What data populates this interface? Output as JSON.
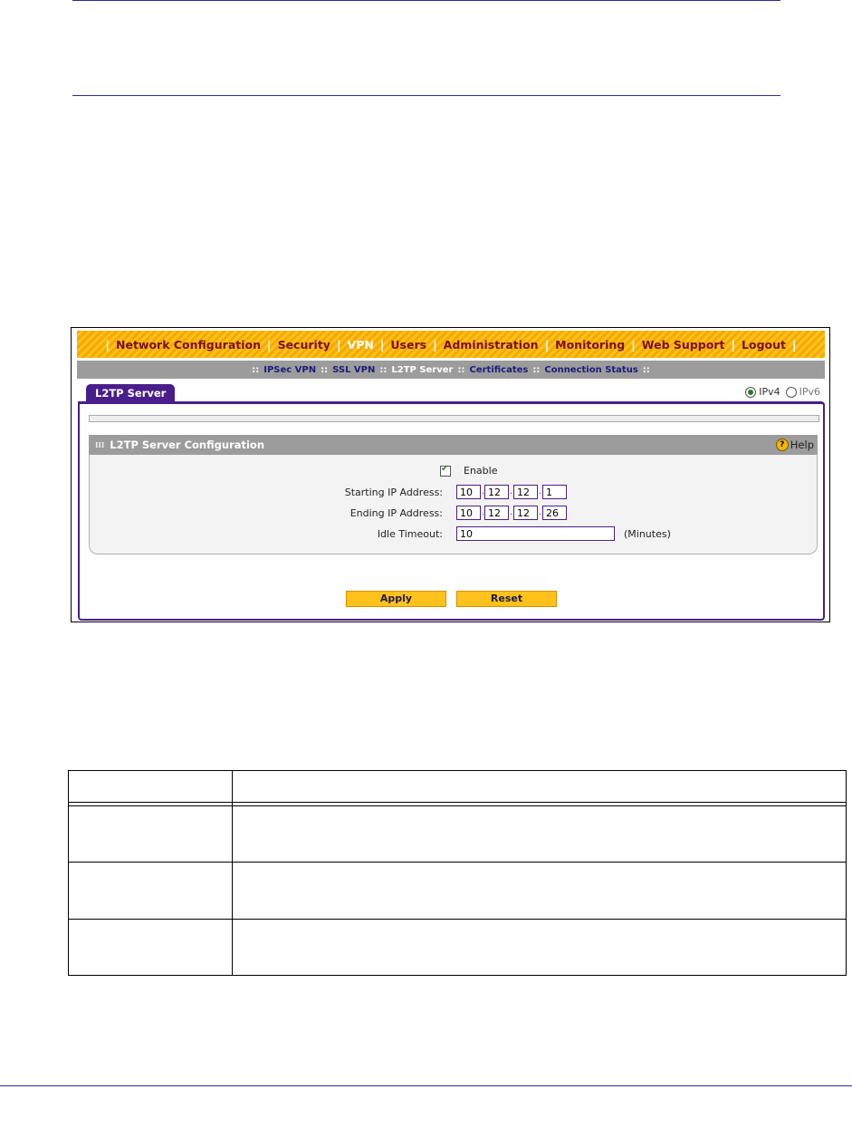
{
  "nav": {
    "items": [
      "Network Configuration",
      "Security",
      "VPN",
      "Users",
      "Administration",
      "Monitoring",
      "Web Support",
      "Logout"
    ],
    "active": "VPN"
  },
  "subnav": {
    "items": [
      "IPSec VPN",
      "SSL VPN",
      "L2TP Server",
      "Certificates",
      "Connection Status"
    ],
    "active": "L2TP Server"
  },
  "tab": {
    "label": "L2TP Server"
  },
  "ip_version": {
    "ipv4": "IPv4",
    "ipv6": "IPv6",
    "selected": "IPv4"
  },
  "section": {
    "title": "L2TP Server Configuration",
    "help": "Help"
  },
  "form": {
    "enable_label": "Enable",
    "enable_checked": true,
    "start_label": "Starting IP Address:",
    "start_ip": [
      "10",
      "12",
      "12",
      "1"
    ],
    "end_label": "Ending IP Address:",
    "end_ip": [
      "10",
      "12",
      "12",
      "26"
    ],
    "idle_label": "Idle Timeout:",
    "idle_value": "10",
    "idle_unit": "(Minutes)"
  },
  "buttons": {
    "apply": "Apply",
    "reset": "Reset"
  },
  "colors": {
    "nav_orange": "#ffc21a",
    "tab_purple": "#4a1e8a",
    "bar_gray": "#9c9c9c"
  }
}
